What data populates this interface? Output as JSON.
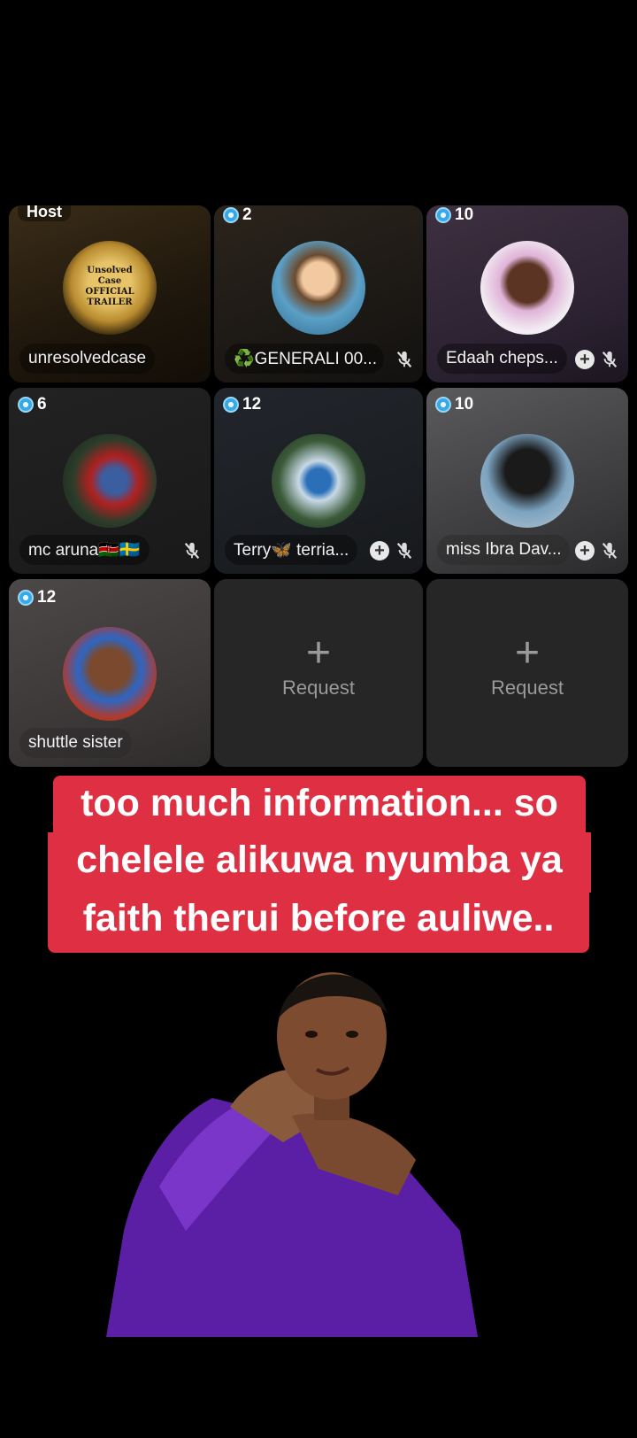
{
  "tiles": [
    {
      "badge": "Host",
      "name": "unresolvedcase",
      "avatar_lines": [
        "Unsolved",
        "Case",
        "OFFICIAL",
        "TRAILER"
      ]
    },
    {
      "badge": "2",
      "name": "♻️GENERALI 00..."
    },
    {
      "badge": "10",
      "name": "Edaah cheps..."
    },
    {
      "badge": "6",
      "name": "mc aruna🇰🇪🇸🇪"
    },
    {
      "badge": "12",
      "name": "Terry🦋 terria..."
    },
    {
      "badge": "10",
      "name": "miss Ibra Dav..."
    },
    {
      "badge": "12",
      "name": "shuttle sister"
    }
  ],
  "request": {
    "plus": "+",
    "label": "Request"
  },
  "caption": {
    "line1": "too much information... so",
    "line2": "chelele alikuwa nyumba ya",
    "line3": "faith therui before auliwe.."
  },
  "colors": {
    "caption_bg": "#de2f43",
    "coin": "#37a9e6"
  }
}
